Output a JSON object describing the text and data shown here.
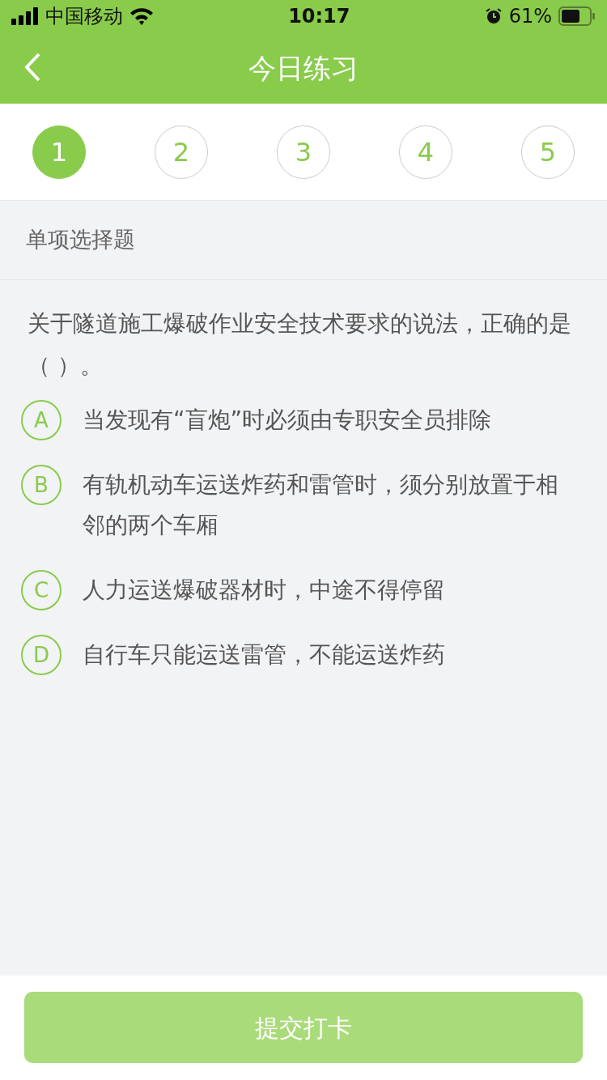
{
  "status_bar": {
    "carrier": "中国移动",
    "time": "10:17",
    "battery": "61%"
  },
  "header": {
    "title": "今日练习"
  },
  "steps": [
    {
      "label": "1",
      "selected": true
    },
    {
      "label": "2",
      "selected": false
    },
    {
      "label": "3",
      "selected": false
    },
    {
      "label": "4",
      "selected": false
    },
    {
      "label": "5",
      "selected": false
    }
  ],
  "question_type": "单项选择题",
  "question": "关于隧道施工爆破作业安全技术要求的说法，正确的是（    ）。",
  "options": [
    {
      "letter": "A",
      "text": "当发现有“盲炮”时必须由专职安全员排除",
      "selected": false
    },
    {
      "letter": "B",
      "text": "有轨机动车运送炸药和雷管时，须分别放置于相邻的两个车厢",
      "selected": false
    },
    {
      "letter": "C",
      "text": "人力运送爆破器材时，中途不得停留",
      "selected": false
    },
    {
      "letter": "D",
      "text": "自行车只能运送雷管，不能运送炸药",
      "selected": false
    }
  ],
  "submit": {
    "label": "提交打卡",
    "disabled": true
  }
}
